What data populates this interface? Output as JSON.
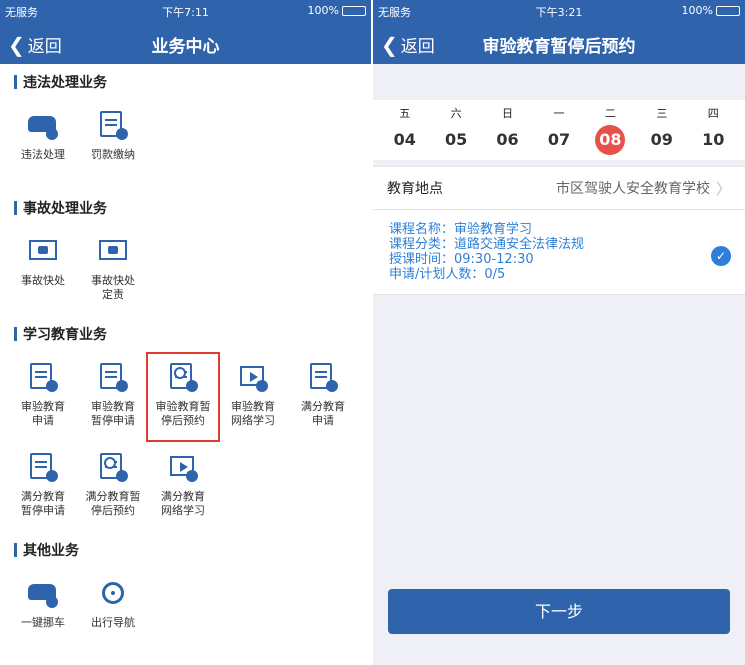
{
  "left": {
    "status": {
      "carrier": "无服务",
      "time": "下午7:11",
      "battery": "100%"
    },
    "nav": {
      "back": "返回",
      "title": "业务中心"
    },
    "sections": [
      {
        "title": "违法处理业务",
        "items": [
          {
            "label": "违法处理",
            "icon": "car-icon"
          },
          {
            "label": "罚款缴纳",
            "icon": "document-icon"
          }
        ]
      },
      {
        "title": "事故处理业务",
        "items": [
          {
            "label": "事故快处",
            "icon": "board-icon"
          },
          {
            "label": "事故快处\n定责",
            "icon": "board-icon"
          }
        ]
      },
      {
        "title": "学习教育业务",
        "items": [
          {
            "label": "审验教育\n申请",
            "icon": "document-icon"
          },
          {
            "label": "审验教育\n暂停申请",
            "icon": "pause-icon"
          },
          {
            "label": "审验教育暂\n停后预约",
            "icon": "clock-icon",
            "highlighted": true
          },
          {
            "label": "审验教育\n网络学习",
            "icon": "play-icon"
          },
          {
            "label": "满分教育\n申请",
            "icon": "document-icon"
          },
          {
            "label": "满分教育\n暂停申请",
            "icon": "pause-icon"
          },
          {
            "label": "满分教育暂\n停后预约",
            "icon": "clock-icon"
          },
          {
            "label": "满分教育\n网络学习",
            "icon": "play-icon"
          }
        ]
      },
      {
        "title": "其他业务",
        "items": [
          {
            "label": "一键挪车",
            "icon": "car-icon"
          },
          {
            "label": "出行导航",
            "icon": "steering-wheel-icon"
          }
        ]
      }
    ]
  },
  "right": {
    "status": {
      "carrier": "无服务",
      "time": "下午3:21",
      "battery": "100%"
    },
    "nav": {
      "back": "返回",
      "title": "审验教育暂停后预约"
    },
    "week": [
      {
        "wd": "五",
        "dn": "04"
      },
      {
        "wd": "六",
        "dn": "05"
      },
      {
        "wd": "日",
        "dn": "06"
      },
      {
        "wd": "一",
        "dn": "07"
      },
      {
        "wd": "二",
        "dn": "08",
        "selected": true
      },
      {
        "wd": "三",
        "dn": "09"
      },
      {
        "wd": "四",
        "dn": "10"
      }
    ],
    "location": {
      "label": "教育地点",
      "value": "市区驾驶人安全教育学校"
    },
    "course": {
      "name": "课程名称：审验教育学习",
      "category": "课程分类：道路交通安全法律法规",
      "time": "授课时间：09:30-12:30",
      "quota": "申请/计划人数：0/5"
    },
    "next_button": "下一步"
  },
  "colors": {
    "primary": "#2f64ad",
    "selected_day": "#e8514a",
    "course_text": "#2d7fd8",
    "highlight_border": "#e03b2f"
  }
}
